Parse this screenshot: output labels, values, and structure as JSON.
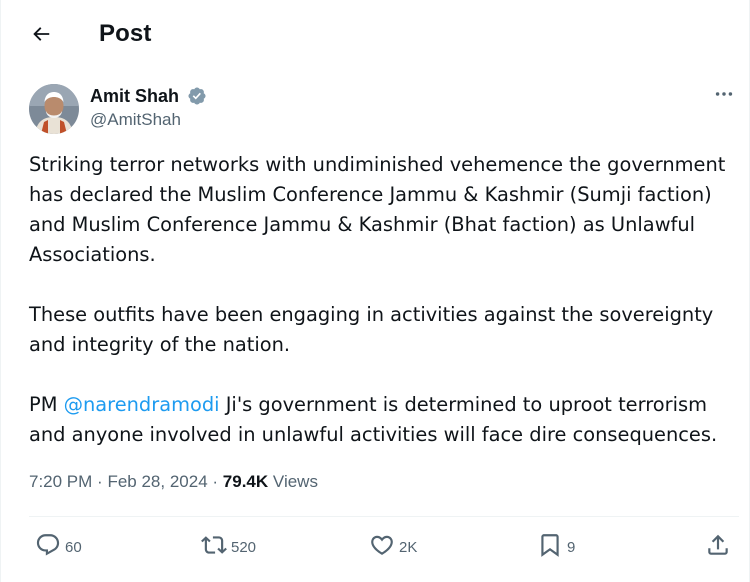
{
  "header": {
    "title": "Post",
    "back_icon": "arrow-left-icon"
  },
  "author": {
    "name": "Amit Shah",
    "handle": "@AmitShah",
    "verified_color": "#829aab"
  },
  "post": {
    "para1": [
      "Striking terror networks with undiminished vehemence the government",
      "has declared the Muslim Conference Jammu & Kashmir (Sumji faction)",
      "and Muslim Conference Jammu & Kashmir (Bhat faction) as Unlawful",
      "Associations."
    ],
    "para2": [
      "These outfits have been engaging in activities against the sovereignty",
      "and integrity of the nation."
    ],
    "para3": {
      "prefix": "PM ",
      "mention": "@narendramodi",
      "suffix": " Ji's government is determined to uproot terrorism",
      "line2": "and anyone involved in unlawful activities will face dire consequences."
    },
    "time": "7:20 PM",
    "separator": "·",
    "date": "Feb 28, 2024",
    "views_count": "79.4K",
    "views_label": "Views"
  },
  "actions": {
    "replies": "60",
    "reposts": "520",
    "likes": "2K",
    "bookmarks": "9"
  },
  "colors": {
    "text": "#0f1419",
    "secondary": "#536471",
    "accent": "#1d9bf0",
    "divider": "#eff3f4"
  }
}
